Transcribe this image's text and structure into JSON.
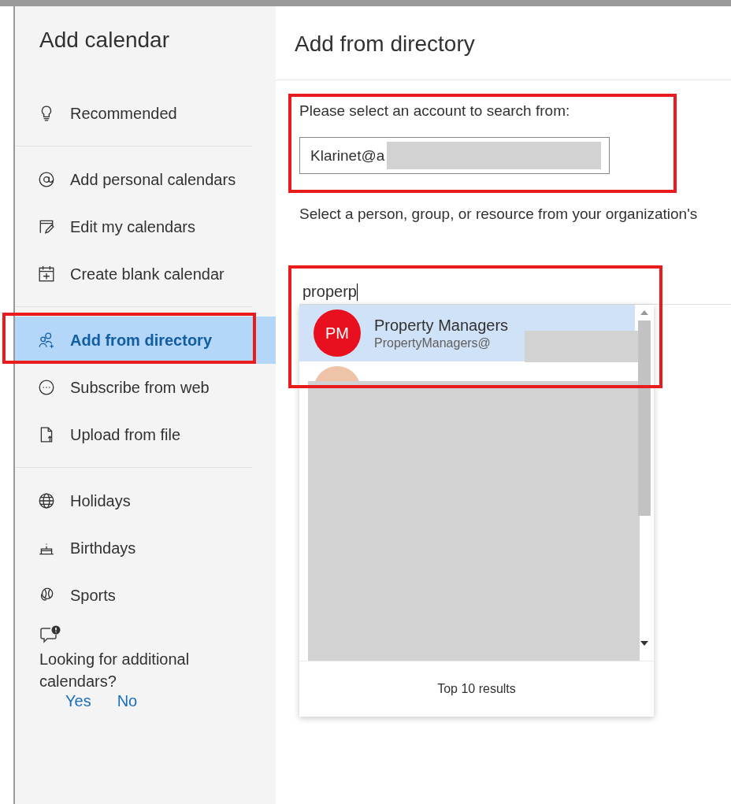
{
  "dialog_title": "Add calendar",
  "nav_groups": [
    [
      {
        "label": "Recommended",
        "selected": false
      }
    ],
    [
      {
        "label": "Add personal calendars",
        "selected": false
      },
      {
        "label": "Edit my calendars",
        "selected": false
      },
      {
        "label": "Create blank calendar",
        "selected": false
      }
    ],
    [
      {
        "label": "Add from directory",
        "selected": true
      },
      {
        "label": "Subscribe from web",
        "selected": false
      },
      {
        "label": "Upload from file",
        "selected": false
      }
    ],
    [
      {
        "label": "Holidays",
        "selected": false
      },
      {
        "label": "Birthdays",
        "selected": false
      },
      {
        "label": "Sports",
        "selected": false
      }
    ]
  ],
  "feedback": {
    "question": "Looking for additional calendars?",
    "yes": "Yes",
    "no": "No"
  },
  "panel": {
    "title": "Add from directory",
    "account_label": "Please select an account to search from:",
    "account_value": "Klarinet@a",
    "description": "Select a person, group, or resource from your organization's",
    "search_value": "properp",
    "results": [
      {
        "kind": "person",
        "initials": "PM",
        "name": "Property Managers",
        "email": "PropertyManagers@",
        "color": "#e8101e",
        "selected": true
      },
      {
        "kind": "hidden",
        "color": "#efc3a8",
        "selected": false
      }
    ],
    "results_footer": "Top 10 results"
  }
}
